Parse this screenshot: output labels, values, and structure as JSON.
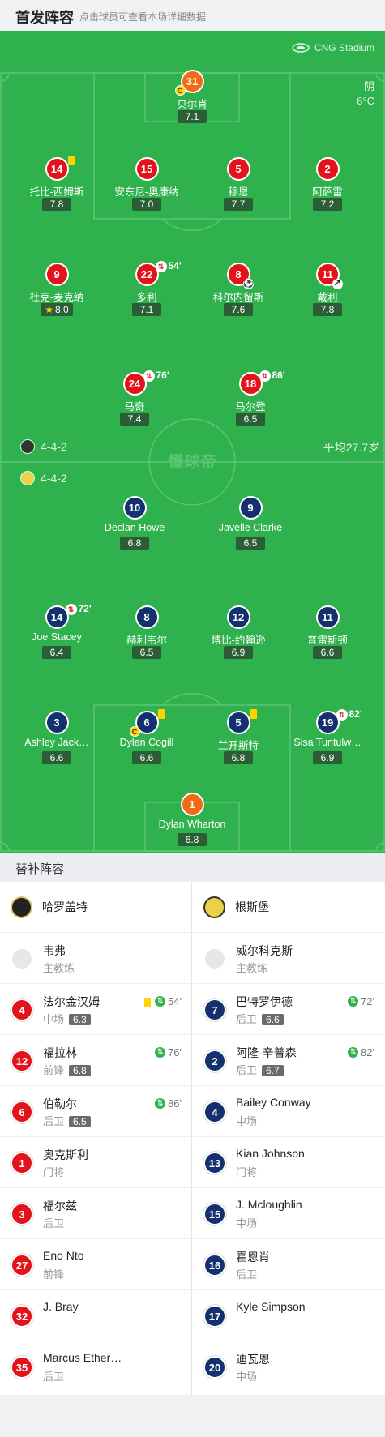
{
  "header": {
    "title": "首发阵容",
    "subtitle": "点击球员可查看本场详细数据"
  },
  "pitch": {
    "stadium": "CNG Stadium",
    "weather": "阴",
    "temperature": "6°C",
    "watermark": "懂球帝",
    "home_formation": "4-4-2",
    "away_formation": "4-4-2",
    "avg_age": "平均27.7岁"
  },
  "home_players": [
    {
      "num": "31",
      "name": "贝尔肖",
      "rating": "7.1"
    },
    {
      "num": "14",
      "name": "托比-西姆斯",
      "rating": "7.8"
    },
    {
      "num": "15",
      "name": "安东尼-奥康纳",
      "rating": "7.0"
    },
    {
      "num": "5",
      "name": "穆恩",
      "rating": "7.7"
    },
    {
      "num": "2",
      "name": "阿萨雷",
      "rating": "7.2"
    },
    {
      "num": "9",
      "name": "杜克-麦克纳",
      "rating": "8.0"
    },
    {
      "num": "22",
      "name": "多利",
      "rating": "7.1",
      "sub": "54'"
    },
    {
      "num": "8",
      "name": "科尔内留斯",
      "rating": "7.6"
    },
    {
      "num": "11",
      "name": "戴利",
      "rating": "7.8"
    },
    {
      "num": "24",
      "name": "马奇",
      "rating": "7.4",
      "sub": "76'"
    },
    {
      "num": "18",
      "name": "马尔登",
      "rating": "6.5",
      "sub": "86'"
    }
  ],
  "away_players": [
    {
      "num": "10",
      "name": "Declan Howe",
      "rating": "6.8"
    },
    {
      "num": "9",
      "name": "Javelle Clarke",
      "rating": "6.5"
    },
    {
      "num": "14",
      "name": "Joe Stacey",
      "rating": "6.4",
      "sub": "72'"
    },
    {
      "num": "8",
      "name": "赫利韦尔",
      "rating": "6.5"
    },
    {
      "num": "12",
      "name": "博比-约翰逊",
      "rating": "6.9"
    },
    {
      "num": "11",
      "name": "普雷斯顿",
      "rating": "6.6"
    },
    {
      "num": "3",
      "name": "Ashley Jack…",
      "rating": "6.6"
    },
    {
      "num": "6",
      "name": "Dylan Cogill",
      "rating": "6.6"
    },
    {
      "num": "5",
      "name": "兰开斯特",
      "rating": "6.8"
    },
    {
      "num": "19",
      "name": "Sisa Tuntulw…",
      "rating": "6.9",
      "sub": "82'"
    },
    {
      "num": "1",
      "name": "Dylan Wharton",
      "rating": "6.8"
    }
  ],
  "subs": {
    "title": "替补阵容",
    "home_team": "哈罗盖特",
    "away_team": "根斯堡",
    "home": [
      {
        "name": "韦弗",
        "role": "主教练"
      },
      {
        "num": "4",
        "name": "法尔金汉姆",
        "role": "中场",
        "rating": "6.3",
        "sub": "54'"
      },
      {
        "num": "12",
        "name": "福拉林",
        "role": "前锋",
        "rating": "6.8",
        "sub": "76'"
      },
      {
        "num": "6",
        "name": "伯勒尔",
        "role": "后卫",
        "rating": "6.5",
        "sub": "86'"
      },
      {
        "num": "1",
        "name": "奥克斯利",
        "role": "门将"
      },
      {
        "num": "3",
        "name": "福尔兹",
        "role": "后卫"
      },
      {
        "num": "27",
        "name": "Eno Nto",
        "role": "前锋"
      },
      {
        "num": "32",
        "name": "J. Bray",
        "role": ""
      },
      {
        "num": "35",
        "name": "Marcus Ether…",
        "role": "后卫"
      }
    ],
    "away": [
      {
        "name": "威尔科克斯",
        "role": "主教练"
      },
      {
        "num": "7",
        "name": "巴特罗伊德",
        "role": "后卫",
        "rating": "6.6",
        "sub": "72'"
      },
      {
        "num": "2",
        "name": "阿隆-辛普森",
        "role": "后卫",
        "rating": "6.7",
        "sub": "82'"
      },
      {
        "num": "4",
        "name": "Bailey Conway",
        "role": "中场"
      },
      {
        "num": "13",
        "name": "Kian Johnson",
        "role": "门将"
      },
      {
        "num": "15",
        "name": "J. Mcloughlin",
        "role": "中场"
      },
      {
        "num": "16",
        "name": "霍恩肖",
        "role": "后卫"
      },
      {
        "num": "17",
        "name": "Kyle Simpson",
        "role": ""
      },
      {
        "num": "20",
        "name": "迪瓦恩",
        "role": "中场"
      }
    ]
  }
}
